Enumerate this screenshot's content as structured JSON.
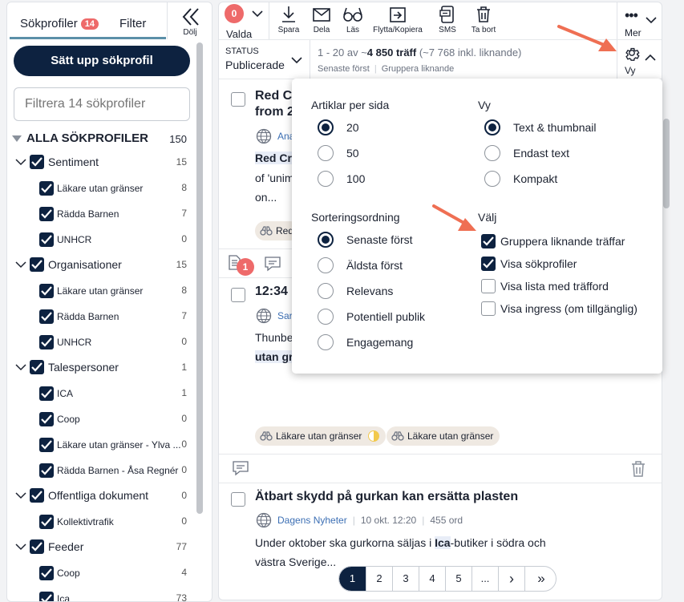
{
  "left_panel": {
    "tabs": [
      {
        "label": "Sökprofiler",
        "badge": "14"
      },
      {
        "label": "Filter"
      }
    ],
    "collapse_label": "Dölj",
    "setup_button": "Sätt upp sökprofil",
    "filter_placeholder": "Filtrera 14 sökprofiler",
    "all_profiles": {
      "label": "ALLA SÖKPROFILER",
      "count": "150"
    },
    "tree": [
      {
        "label": "Sentiment",
        "count": "15",
        "level": 0
      },
      {
        "label": "Läkare utan gränser",
        "count": "8",
        "level": 1
      },
      {
        "label": "Rädda Barnen",
        "count": "7",
        "level": 1
      },
      {
        "label": "UNHCR",
        "count": "0",
        "level": 1
      },
      {
        "label": "Organisationer",
        "count": "15",
        "level": 0
      },
      {
        "label": "Läkare utan gränser",
        "count": "8",
        "level": 1
      },
      {
        "label": "Rädda Barnen",
        "count": "7",
        "level": 1
      },
      {
        "label": "UNHCR",
        "count": "0",
        "level": 1
      },
      {
        "label": "Talespersoner",
        "count": "1",
        "level": 0
      },
      {
        "label": "ICA",
        "count": "1",
        "level": 1
      },
      {
        "label": "Coop",
        "count": "0",
        "level": 1
      },
      {
        "label": "Läkare utan gränser - Ylva ...",
        "count": "0",
        "level": 1
      },
      {
        "label": "Rädda Barnen - Åsa Regnér",
        "count": "0",
        "level": 1
      },
      {
        "label": "Offentliga dokument",
        "count": "0",
        "level": 0
      },
      {
        "label": "Kollektivtrafik",
        "count": "0",
        "level": 1
      },
      {
        "label": "Feeder",
        "count": "77",
        "level": 0
      },
      {
        "label": "Coop",
        "count": "4",
        "level": 1
      },
      {
        "label": "Ica",
        "count": "73",
        "level": 1
      }
    ]
  },
  "toolbar": {
    "selected": {
      "count": "0",
      "label": "Valda"
    },
    "items": [
      {
        "label": "Spara",
        "icon": "download-icon"
      },
      {
        "label": "Dela",
        "icon": "mail-icon"
      },
      {
        "label": "Läs",
        "icon": "glasses-icon"
      },
      {
        "label": "Flytta/Kopiera",
        "icon": "move-icon"
      },
      {
        "label": "SMS",
        "icon": "sms-icon"
      },
      {
        "label": "Ta bort",
        "icon": "trash-icon"
      }
    ],
    "more_label": "Mer"
  },
  "status_bar": {
    "status_label": "STATUS",
    "status_value": "Publicerade",
    "range": "1 - 20 av ~",
    "total": "4 850 träff",
    "total_incl": " (~7 768 inkl. liknande)",
    "sort_label": "Senaste först",
    "group_label": "Gruppera liknande",
    "view_label": "Vy"
  },
  "view_menu": {
    "per_page": {
      "title": "Artiklar per sida",
      "options": [
        "20",
        "50",
        "100"
      ],
      "selected": "20"
    },
    "view": {
      "title": "Vy",
      "options": [
        "Text & thumbnail",
        "Endast text",
        "Kompakt"
      ],
      "selected": "Text & thumbnail"
    },
    "sort": {
      "title": "Sorteringsordning",
      "options": [
        "Senaste först",
        "Äldsta först",
        "Relevans",
        "Potentiell publik",
        "Engagemang"
      ],
      "selected": "Senaste först"
    },
    "choose": {
      "title": "Välj",
      "options": [
        {
          "label": "Gruppera liknande träffar",
          "checked": true
        },
        {
          "label": "Visa sökprofiler",
          "checked": true
        },
        {
          "label": "Visa lista med träfford",
          "checked": false
        },
        {
          "label": "Visa ingress (om tillgänglig)",
          "checked": false
        }
      ]
    }
  },
  "articles": [
    {
      "title_a": "Red Cr",
      "title_b": "from 2",
      "source": "Ana",
      "snippet1": "Red Cro",
      "snippet2": "of 'unim",
      "snippet3": "on...",
      "tag": "Red"
    },
    {
      "title_a": "12:34 -",
      "source": "Sar",
      "snippet1": "Thunbe",
      "snippet2": "utan gr",
      "similar_count": "1",
      "tags": [
        "Läkare utan gränser",
        "Läkare utan gränser"
      ]
    },
    {
      "title": "Ätbart skydd på gurkan kan ersätta plasten",
      "source": "Dagens Nyheter",
      "date": "10 okt. 12:20",
      "reads": "455 ord",
      "snippet_pre": "Under oktober ska gurkorna säljas i ",
      "snippet_hl": "Ica",
      "snippet_post": "-butiker i södra och",
      "snippet2": "västra Sverige..."
    }
  ],
  "pagination": [
    "1",
    "2",
    "3",
    "4",
    "5",
    "...",
    "›",
    "»"
  ],
  "colors": {
    "navy": "#0d2240",
    "badge": "#ee6a6a",
    "accent": "#5b8fa8",
    "link": "#3c6fb4",
    "tag_bg": "#efe9e2",
    "arrow": "#ef6f53"
  }
}
